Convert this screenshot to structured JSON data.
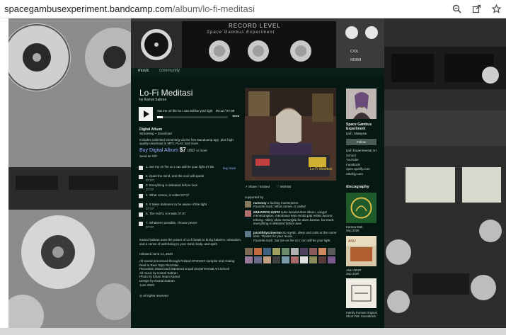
{
  "browser": {
    "url_host": "spacegambusexperiment.bandcamp.com",
    "url_path": "/album/lo-fi-meditasi",
    "icons": [
      "zoom-icon",
      "share-icon",
      "star-icon"
    ]
  },
  "header": {
    "level_label": "RECORD LEVEL",
    "banner_text": "Space Gambus Experiment",
    "knob_labels": [
      "C/OL",
      "NORM"
    ]
  },
  "nav": {
    "music": "music",
    "community": "community"
  },
  "album": {
    "title": "Lo-Fi Meditasi",
    "by": "by Kamal Sabran",
    "now_playing": "Sat me on fire so I can still be your light",
    "time": "00:12 / 07:08",
    "format": "Digital Album",
    "format_sub": "Streaming + Download",
    "includes": "Includes unlimited streaming via the free Bandcamp app, plus high-quality download in MP3, FLAC and more.",
    "buy_label": "Buy Digital Album",
    "price": "$7",
    "currency": "USD",
    "or_more": "or more",
    "send_gift": "Send as Gift",
    "buy_track": "buy track"
  },
  "tracks": [
    {
      "num": "1.",
      "name": "Set my on fire so I can still be your light",
      "dur": "07:08"
    },
    {
      "num": "2.",
      "name": "Quiet the mind, and the soul will speak",
      "dur": "07:07"
    },
    {
      "num": "3.",
      "name": "Everything is defeated before love",
      "dur": "07:07"
    },
    {
      "num": "4.",
      "name": "What comes, is called",
      "dur": "07:07"
    },
    {
      "num": "5.",
      "name": "It takes darkness to be aware of the light",
      "dur": "07:07"
    },
    {
      "num": "6.",
      "name": "The SUFU is Inside",
      "dur": "07:07"
    },
    {
      "num": "7.",
      "name": "Whatever possible, choose peace",
      "dur": "07:07"
    }
  ],
  "description": {
    "text": "Kamal Sabran uses the power of Lo-fi beats to bring balance, relaxation, and a sense of well-being to your mind, body, and spirit.",
    "released": "released June 14, 2020",
    "credits": [
      "All sound processed through Roland SP404SX sampler and Analog",
      "Reel to Reel Tape Recorder",
      "Recorded, Mixed and Mastered at Ipoh Experimental Art School",
      "All music by Kamal Sabran",
      "Photo by Ibrian Imam Kamal",
      "Design by Kamal Sabran",
      "June 2020"
    ],
    "rights": "all rights reserved"
  },
  "actions": {
    "share": "Share / Embed",
    "wishlist": "Wishlist"
  },
  "supported": {
    "label": "supported by",
    "items": [
      {
        "user": "nuvsnoy",
        "text": "a fucking masterpiece",
        "fav": "Favorite track: What comes, is called."
      },
      {
        "user": "MUHAROS HAFIZ",
        "text": "suka kesuluruhan album, sangat menenangkan, membawa kepi minda pak relaks kerana tekong. Akkey akan menungku ke alam bantan, fav track: Everything is defeated before love",
        "fav": ""
      },
      {
        "user": "jacobfidyozinermo",
        "text": "So mystic, deep and calm at the same time. Thanks for your music.",
        "fav": "Favorite track: Sat me on fire so I can still be your light."
      }
    ]
  },
  "artist": {
    "name": "Space Gambus Experiment",
    "location": "Ipoh, Malaysia",
    "follow": "Follow",
    "links": [
      "Ipoh Experimental Art School",
      "YouTube",
      "Facebook",
      "open.spotify.com",
      "nthahjy.com"
    ]
  },
  "discography": {
    "label": "discography",
    "items": [
      {
        "title": "Karana Mah",
        "date": "Sep 2020"
      },
      {
        "title": "ANU ZIKIR",
        "date": "Sep 2020"
      },
      {
        "title": "Family Portrait Original Short Film Soundtrack",
        "date": ""
      }
    ]
  },
  "colors": {
    "content_bg": "#061813",
    "link": "#9db2ff",
    "text": "#cfd8d4"
  }
}
